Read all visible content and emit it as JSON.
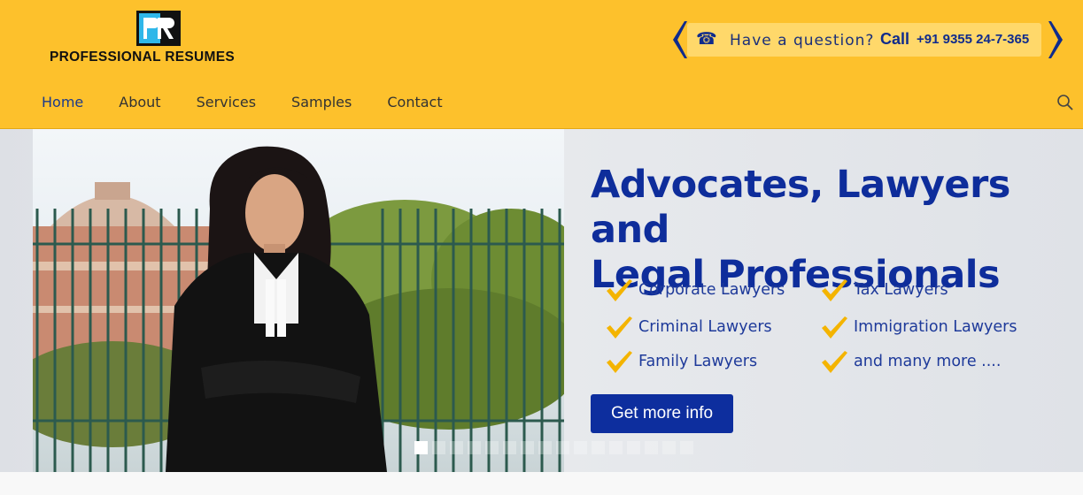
{
  "brand": {
    "logo_text": "PROFESSIONAL RESUMES",
    "colors": {
      "header_bg": "#fdc12c",
      "primary_blue": "#0e2d9b",
      "nav_active": "#1b3a8c"
    }
  },
  "contact": {
    "question": "Have a question?",
    "call_label": "Call",
    "phone": "+91 9355 24-7-365",
    "icon": "phone-icon"
  },
  "nav": {
    "items": [
      {
        "label": "Home",
        "active": true
      },
      {
        "label": "About"
      },
      {
        "label": "Services"
      },
      {
        "label": "Samples"
      },
      {
        "label": "Contact"
      }
    ],
    "search_icon": "search-icon"
  },
  "hero": {
    "title_line1": "Advocates, Lawyers and",
    "title_line2": "Legal Professionals",
    "list": [
      "Corporate Lawyers",
      "Tax Lawyers",
      "Criminal Lawyers",
      "Immigration Lawyers",
      "Family Lawyers",
      "and many more ...."
    ],
    "cta_label": "Get more info",
    "slide_count": 16,
    "active_slide": 1
  }
}
